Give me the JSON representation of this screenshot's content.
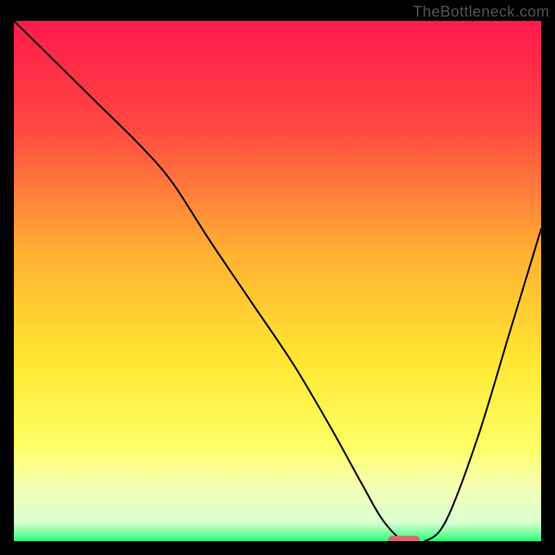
{
  "watermark": "TheBottleneck.com",
  "chart_data": {
    "type": "line",
    "title": "",
    "xlabel": "",
    "ylabel": "",
    "xlim": [
      0,
      100
    ],
    "ylim": [
      0,
      100
    ],
    "grid": false,
    "legend": false,
    "background_gradient": {
      "stops": [
        {
          "pos": 0.0,
          "color": "#ff1a4b"
        },
        {
          "pos": 0.2,
          "color": "#ff4642"
        },
        {
          "pos": 0.45,
          "color": "#ffb233"
        },
        {
          "pos": 0.65,
          "color": "#ffe631"
        },
        {
          "pos": 0.82,
          "color": "#fdff66"
        },
        {
          "pos": 0.9,
          "color": "#f3ffb8"
        },
        {
          "pos": 0.965,
          "color": "#d8ffd0"
        },
        {
          "pos": 1.0,
          "color": "#2cff7a"
        }
      ]
    },
    "series": [
      {
        "name": "bottleneck-curve",
        "color": "#000000",
        "x": [
          0,
          8,
          16,
          24,
          30,
          37,
          45,
          53,
          60,
          66,
          70,
          74,
          78,
          82,
          88,
          94,
          100
        ],
        "y": [
          100,
          92,
          84,
          76,
          69,
          58,
          46,
          34,
          22,
          11,
          4,
          0,
          0,
          4,
          20,
          40,
          60
        ]
      }
    ],
    "marker": {
      "name": "highlight-pill",
      "x": 74,
      "y": 0,
      "color": "#d46a6a",
      "width_pct": 6,
      "height_pct": 1.5
    }
  }
}
